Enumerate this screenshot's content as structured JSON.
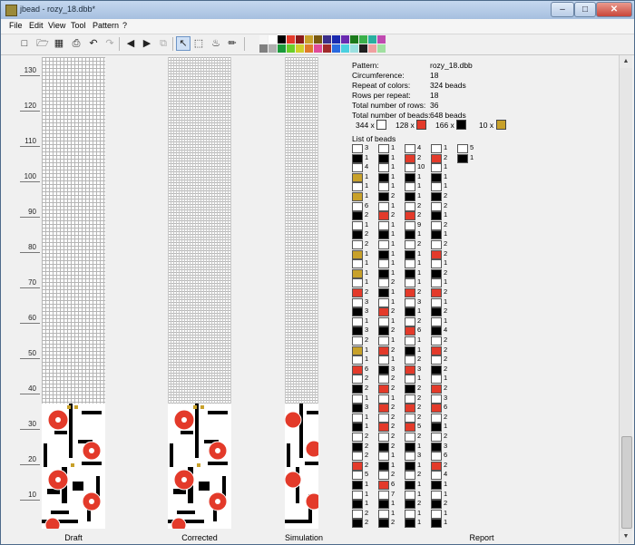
{
  "window": {
    "title": "jbead - rozy_18.dbb*",
    "minimize": "–",
    "maximize": "□",
    "close": "✕"
  },
  "menu": [
    "File",
    "Edit",
    "View",
    "Tool",
    "Pattern",
    "?"
  ],
  "toolbar_icons": [
    "new-icon",
    "open-icon",
    "save-icon",
    "print-icon",
    "undo-icon",
    "redo-icon",
    "arrow-left-icon",
    "arrow-right-icon",
    "rotate-icon",
    "pointer-icon",
    "rect-select-icon",
    "fill-icon",
    "pipette-icon"
  ],
  "palette": [
    "#f5f5f5",
    "#ffffff",
    "#000000",
    "#e33a2a",
    "#8b1a1a",
    "#c8a12a",
    "#7a5a10",
    "#3b2f8a",
    "#1a2ab0",
    "#6a2ab0",
    "#1c7a1c",
    "#3ab04a",
    "#2ab0a0",
    "#c04ab0",
    "#808080",
    "#b0b0b0",
    "#1a9a3a",
    "#6ad02a",
    "#d0d02a",
    "#e07a2a",
    "#e04a9a",
    "#a02a2a",
    "#2a6ae0",
    "#4ad0e0",
    "#9ae0e0",
    "#202020",
    "#f0a0a0",
    "#a0e0a0"
  ],
  "ruler": {
    "labels": [
      "130",
      "120",
      "110",
      "100",
      "90",
      "80",
      "70",
      "60",
      "50",
      "40",
      "30",
      "20",
      "10"
    ]
  },
  "panels": {
    "draft": "Draft",
    "corrected": "Corrected",
    "simulation": "Simulation",
    "report": "Report"
  },
  "report": {
    "pattern_label": "Pattern:",
    "pattern": "rozy_18.dbb",
    "circumference_label": "Circumference:",
    "circumference": "18",
    "repeat_colors_label": "Repeat of colors:",
    "repeat_colors": "324 beads",
    "rows_per_repeat_label": "Rows per repeat:",
    "rows_per_repeat": "18",
    "total_rows_label": "Total number of rows:",
    "total_rows": "36",
    "total_beads_label": "Total number of beads:",
    "total_beads": "648 beads",
    "counts": [
      {
        "text": "344 x",
        "color": "#ffffff"
      },
      {
        "text": "128 x",
        "color": "#e33a2a"
      },
      {
        "text": "166 x",
        "color": "#000000"
      },
      {
        "text": "10 x",
        "color": "#c8a12a"
      }
    ],
    "list_title": "List of beads",
    "colors": {
      "W": "#ffffff",
      "B": "#000000",
      "R": "#e33a2a",
      "G": "#c8a12a"
    },
    "columns": [
      [
        [
          "W",
          "3"
        ],
        [
          "B",
          "1"
        ],
        [
          "W",
          "4"
        ],
        [
          "G",
          "1"
        ],
        [
          "W",
          "1"
        ],
        [
          "G",
          "1"
        ],
        [
          "W",
          "6"
        ],
        [
          "B",
          "2"
        ],
        [
          "W",
          "1"
        ],
        [
          "B",
          "2"
        ],
        [
          "W",
          "2"
        ],
        [
          "G",
          "1"
        ],
        [
          "W",
          "1"
        ],
        [
          "G",
          "1"
        ],
        [
          "W",
          "1"
        ],
        [
          "R",
          "2"
        ],
        [
          "W",
          "3"
        ],
        [
          "B",
          "3"
        ],
        [
          "W",
          "1"
        ],
        [
          "B",
          "3"
        ],
        [
          "W",
          "2"
        ],
        [
          "G",
          "1"
        ],
        [
          "W",
          "1"
        ],
        [
          "R",
          "6"
        ],
        [
          "W",
          "2"
        ],
        [
          "B",
          "2"
        ],
        [
          "W",
          "1"
        ],
        [
          "B",
          "3"
        ],
        [
          "W",
          "1"
        ],
        [
          "B",
          "1"
        ],
        [
          "W",
          "2"
        ],
        [
          "B",
          "2"
        ],
        [
          "W",
          "2"
        ],
        [
          "R",
          "2"
        ],
        [
          "W",
          "5"
        ],
        [
          "B",
          "1"
        ],
        [
          "W",
          "1"
        ],
        [
          "B",
          "1"
        ],
        [
          "W",
          "2"
        ],
        [
          "B",
          "2"
        ]
      ],
      [
        [
          "W",
          "1"
        ],
        [
          "B",
          "1"
        ],
        [
          "W",
          "1"
        ],
        [
          "B",
          "1"
        ],
        [
          "W",
          "1"
        ],
        [
          "B",
          "2"
        ],
        [
          "W",
          "1"
        ],
        [
          "R",
          "2"
        ],
        [
          "W",
          "1"
        ],
        [
          "B",
          "1"
        ],
        [
          "W",
          "1"
        ],
        [
          "B",
          "1"
        ],
        [
          "W",
          "1"
        ],
        [
          "B",
          "1"
        ],
        [
          "W",
          "2"
        ],
        [
          "B",
          "1"
        ],
        [
          "W",
          "1"
        ],
        [
          "R",
          "2"
        ],
        [
          "W",
          "1"
        ],
        [
          "B",
          "2"
        ],
        [
          "W",
          "1"
        ],
        [
          "R",
          "2"
        ],
        [
          "W",
          "1"
        ],
        [
          "B",
          "3"
        ],
        [
          "W",
          "2"
        ],
        [
          "R",
          "2"
        ],
        [
          "W",
          "1"
        ],
        [
          "R",
          "2"
        ],
        [
          "W",
          "2"
        ],
        [
          "R",
          "2"
        ],
        [
          "W",
          "2"
        ],
        [
          "B",
          "2"
        ],
        [
          "W",
          "1"
        ],
        [
          "B",
          "1"
        ],
        [
          "W",
          "2"
        ],
        [
          "R",
          "6"
        ],
        [
          "W",
          "7"
        ],
        [
          "B",
          "1"
        ],
        [
          "W",
          "1"
        ],
        [
          "B",
          "2"
        ]
      ],
      [
        [
          "W",
          "4"
        ],
        [
          "R",
          "2"
        ],
        [
          "W",
          "10"
        ],
        [
          "B",
          "1"
        ],
        [
          "W",
          "1"
        ],
        [
          "B",
          "1"
        ],
        [
          "W",
          "2"
        ],
        [
          "R",
          "2"
        ],
        [
          "W",
          "9"
        ],
        [
          "B",
          "1"
        ],
        [
          "W",
          "2"
        ],
        [
          "B",
          "1"
        ],
        [
          "W",
          "1"
        ],
        [
          "B",
          "1"
        ],
        [
          "W",
          "1"
        ],
        [
          "R",
          "2"
        ],
        [
          "W",
          "3"
        ],
        [
          "B",
          "1"
        ],
        [
          "W",
          "2"
        ],
        [
          "R",
          "6"
        ],
        [
          "W",
          "1"
        ],
        [
          "B",
          "1"
        ],
        [
          "W",
          "2"
        ],
        [
          "R",
          "3"
        ],
        [
          "W",
          "1"
        ],
        [
          "B",
          "2"
        ],
        [
          "W",
          "2"
        ],
        [
          "R",
          "2"
        ],
        [
          "W",
          "2"
        ],
        [
          "R",
          "5"
        ],
        [
          "W",
          "2"
        ],
        [
          "B",
          "1"
        ],
        [
          "W",
          "3"
        ],
        [
          "B",
          "1"
        ],
        [
          "W",
          "2"
        ],
        [
          "B",
          "1"
        ],
        [
          "W",
          "1"
        ],
        [
          "B",
          "2"
        ],
        [
          "W",
          "1"
        ],
        [
          "B",
          "1"
        ]
      ],
      [
        [
          "W",
          "1"
        ],
        [
          "R",
          "2"
        ],
        [
          "W",
          "1"
        ],
        [
          "B",
          "1"
        ],
        [
          "W",
          "1"
        ],
        [
          "B",
          "2"
        ],
        [
          "W",
          "2"
        ],
        [
          "B",
          "1"
        ],
        [
          "W",
          "2"
        ],
        [
          "B",
          "1"
        ],
        [
          "W",
          "2"
        ],
        [
          "R",
          "2"
        ],
        [
          "W",
          "1"
        ],
        [
          "B",
          "2"
        ],
        [
          "W",
          "1"
        ],
        [
          "R",
          "2"
        ],
        [
          "W",
          "1"
        ],
        [
          "B",
          "2"
        ],
        [
          "W",
          "1"
        ],
        [
          "B",
          "4"
        ],
        [
          "W",
          "2"
        ],
        [
          "R",
          "2"
        ],
        [
          "W",
          "2"
        ],
        [
          "B",
          "2"
        ],
        [
          "W",
          "1"
        ],
        [
          "R",
          "2"
        ],
        [
          "W",
          "3"
        ],
        [
          "R",
          "6"
        ],
        [
          "W",
          "2"
        ],
        [
          "B",
          "1"
        ],
        [
          "W",
          "2"
        ],
        [
          "B",
          "3"
        ],
        [
          "W",
          "6"
        ],
        [
          "R",
          "2"
        ],
        [
          "W",
          "4"
        ],
        [
          "B",
          "1"
        ],
        [
          "W",
          "1"
        ],
        [
          "B",
          "2"
        ],
        [
          "W",
          "1"
        ],
        [
          "B",
          "1"
        ]
      ],
      [
        [
          "W",
          "5"
        ],
        [
          "B",
          "1"
        ]
      ]
    ]
  }
}
